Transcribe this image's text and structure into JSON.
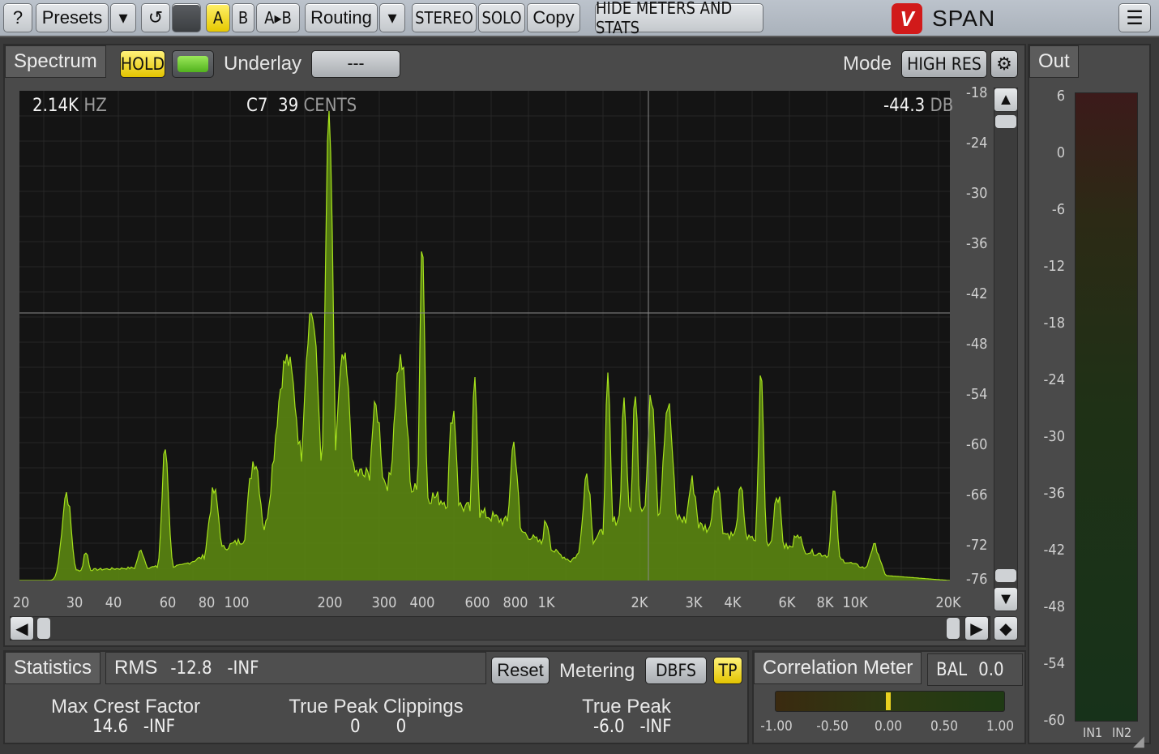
{
  "toolbar": {
    "help": "?",
    "presets": "Presets",
    "dropdown": "▾",
    "undo": "↺",
    "a": "A",
    "b": "B",
    "atob": "A▸B",
    "routing": "Routing",
    "stereo": "STEREO",
    "solo": "SOLO",
    "copy": "Copy",
    "hide_meters": "HIDE METERS AND STATS",
    "logo_mark": "V",
    "app_name": "SPAN",
    "menu": "☰"
  },
  "spectrum": {
    "tab": "Spectrum",
    "hold": "HOLD",
    "underlay_label": "Underlay",
    "underlay_value": "---",
    "mode_label": "Mode",
    "mode_value": "HIGH RES",
    "readout_freq": "2.14K",
    "readout_freq_unit": "HZ",
    "readout_note": "C7  39",
    "readout_note_unit": "CENTS",
    "readout_db": "-44.3",
    "readout_db_unit": "DB",
    "db_ticks": [
      "-18",
      "-24",
      "-30",
      "-36",
      "-42",
      "-48",
      "-54",
      "-60",
      "-66",
      "-72",
      "-76"
    ],
    "freq_ticks": [
      "20",
      "30",
      "40",
      "60",
      "80",
      "100",
      "200",
      "300",
      "400",
      "600",
      "800",
      "1K",
      "2K",
      "3K",
      "4K",
      "6K",
      "8K",
      "10K",
      "20K"
    ],
    "colors": {
      "fill": "#5e8c10",
      "line": "#a6e21c",
      "bg": "#141414"
    }
  },
  "statistics": {
    "tab": "Statistics",
    "rms_label": "RMS",
    "rms_values": "-12.8   -INF",
    "reset": "Reset",
    "metering_label": "Metering",
    "metering_value": "DBFS",
    "tp": "TP",
    "crest_label": "Max Crest Factor",
    "crest_values": "14.6   -INF",
    "clip_label": "True Peak Clippings",
    "clip_values": "0       0",
    "tp_label": "True Peak",
    "tp_values": "-6.0   -INF"
  },
  "correlation": {
    "tab": "Correlation Meter",
    "bal_label": "BAL",
    "bal_value": "0.0",
    "ticks": [
      "-1.00",
      "-0.50",
      "0.00",
      "0.50",
      "1.00"
    ],
    "value": 0.0
  },
  "output": {
    "tab": "Out",
    "ticks": [
      "6",
      "0",
      "-6",
      "-12",
      "-18",
      "-24",
      "-30",
      "-36",
      "-42",
      "-48",
      "-54",
      "-60"
    ],
    "in1": "IN1",
    "in2": "IN2"
  }
}
